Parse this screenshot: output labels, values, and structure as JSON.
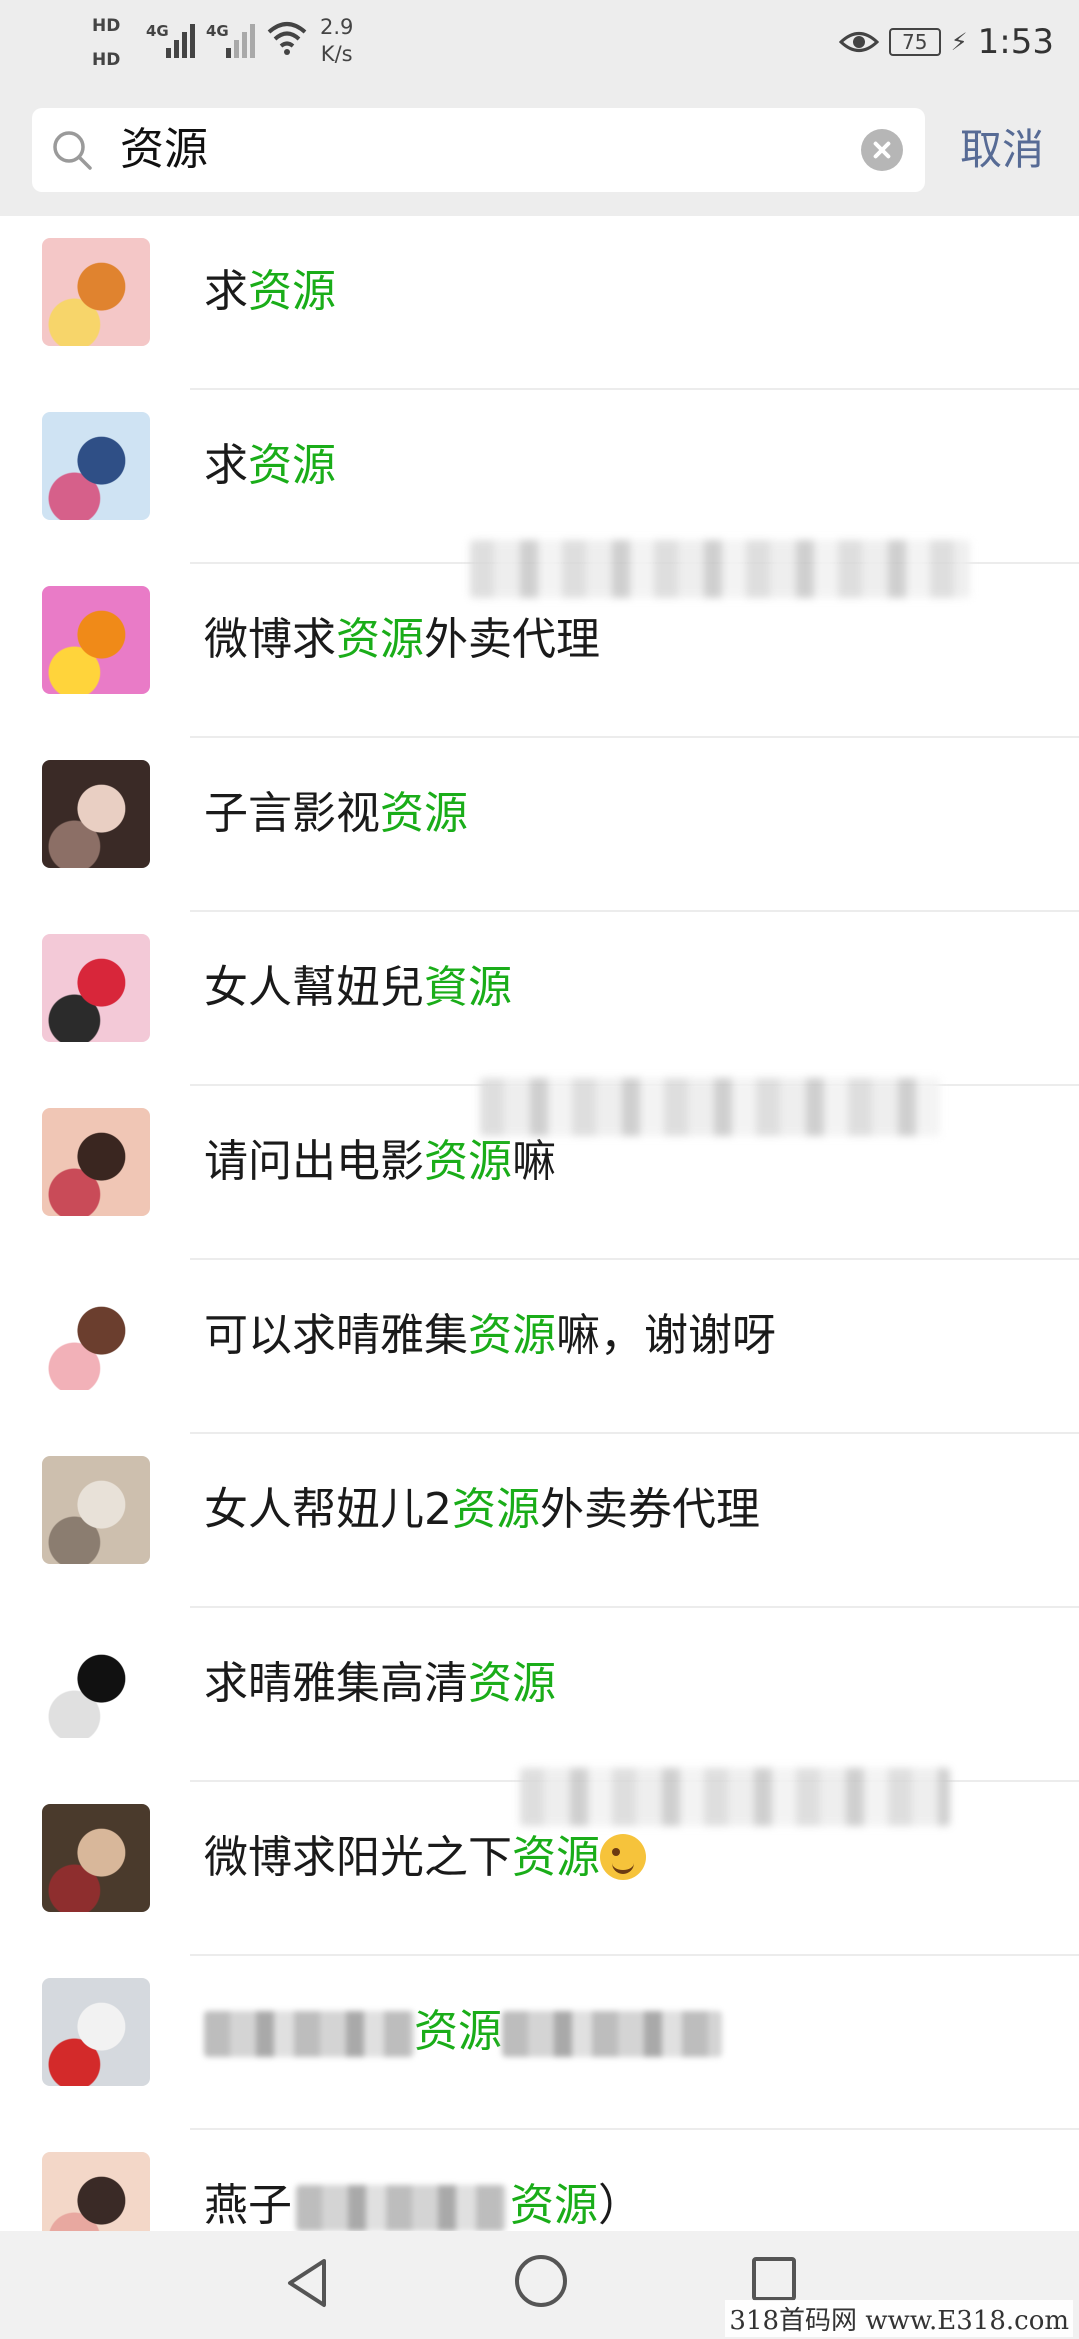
{
  "status_bar": {
    "hd1": "HD",
    "hd2": "HD",
    "net1": "4G",
    "net2": "4G",
    "speed_value": "2.9",
    "speed_unit": "K/s",
    "battery": "75",
    "time": "1:53",
    "icons": [
      "signal-icon",
      "wifi-icon",
      "eye-icon",
      "battery-icon",
      "charging-icon"
    ]
  },
  "search": {
    "query": "资源",
    "cancel_label": "取消"
  },
  "results": [
    {
      "pre": "求",
      "hl": "资源",
      "post": "",
      "avatar_colors": [
        "#f4c7c7",
        "#e0832f",
        "#f7d56a"
      ]
    },
    {
      "pre": "求",
      "hl": "资源",
      "post": "",
      "avatar_colors": [
        "#cfe3f3",
        "#2f4f86",
        "#d6608a"
      ]
    },
    {
      "pre": "微博求",
      "hl": "资源",
      "post": "外卖代理",
      "avatar_colors": [
        "#e97bc7",
        "#f08a18",
        "#ffd43b"
      ]
    },
    {
      "pre": "子言影视",
      "hl": "资源",
      "post": "",
      "avatar_colors": [
        "#3a2a26",
        "#e9cfc3",
        "#8c6f66"
      ]
    },
    {
      "pre": "女人幫妞兒",
      "hl": "資源",
      "post": "",
      "avatar_colors": [
        "#f3c9d7",
        "#d8263a",
        "#2b2b2b"
      ]
    },
    {
      "pre": "请问出电影",
      "hl": "资源",
      "post": "嘛",
      "avatar_colors": [
        "#f0c6b5",
        "#3a2620",
        "#c94b58"
      ]
    },
    {
      "pre": "可以求晴雅集",
      "hl": "资源",
      "post": "嘛，谢谢呀",
      "avatar_colors": [
        "#ffffff",
        "#6b3e2e",
        "#f2b1b8"
      ]
    },
    {
      "pre": "女人帮妞儿2",
      "hl": "资源",
      "post": "外卖券代理",
      "avatar_colors": [
        "#cdbfae",
        "#e8e1d8",
        "#8b7d70"
      ]
    },
    {
      "pre": "求晴雅集高清",
      "hl": "资源",
      "post": "",
      "avatar_colors": [
        "#ffffff",
        "#111111",
        "#e0e0e0"
      ]
    },
    {
      "pre": "微博求阳光之下",
      "hl": "资源",
      "post": "",
      "emoji": "winking-face-emoji",
      "avatar_colors": [
        "#4a3a2c",
        "#d8b79a",
        "#8e2e2e"
      ]
    },
    {
      "pre": "",
      "hl": "资源",
      "post": "",
      "masked": true,
      "avatar_colors": [
        "#d5d9de",
        "#f2f2f2",
        "#d32a2a"
      ]
    },
    {
      "pre": "燕子",
      "hl": "资源",
      "post": "）",
      "masked_middle": true,
      "avatar_colors": [
        "#f3d7c8",
        "#3a2a26",
        "#e8a8a0"
      ]
    }
  ],
  "nav": {
    "icons": [
      "back-icon",
      "home-icon",
      "recent-apps-icon"
    ]
  },
  "watermark": "318首码网 www.E318.com"
}
